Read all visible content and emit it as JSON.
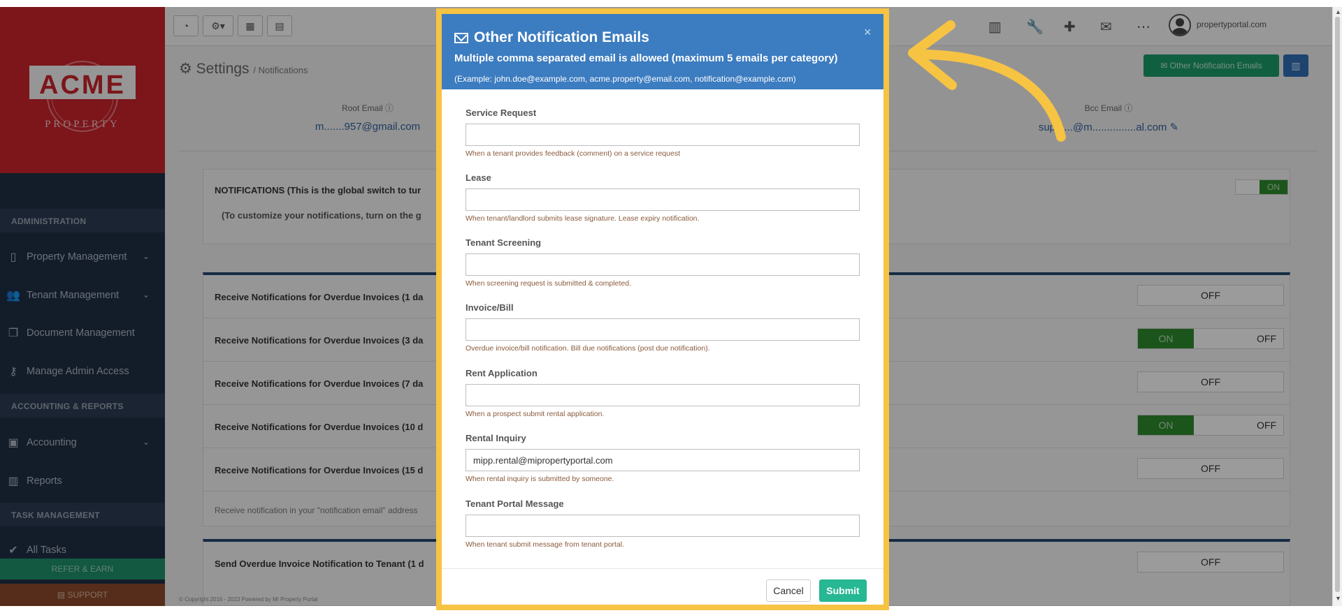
{
  "sidebar": {
    "logo_text": "ACME",
    "logo_sub": "PROPERTY",
    "sections": {
      "administration": "ADMINISTRATION",
      "accounting": "ACCOUNTING & REPORTS",
      "task": "TASK MANAGEMENT"
    },
    "items": {
      "property": "Property Management",
      "tenant": "Tenant Management",
      "document": "Document Management",
      "admin_access": "Manage Admin Access",
      "accounting": "Accounting",
      "reports": "Reports",
      "all_tasks": "All Tasks"
    },
    "refer": "REFER & EARN",
    "support": "SUPPORT"
  },
  "topbar": {
    "user_email": "propertyportal.com"
  },
  "page": {
    "title": "Settings",
    "breadcrumb": "/ Notifications",
    "other_btn": "Other Notification Emails",
    "root_email_label": "Root Email",
    "root_email_value": "m.......957@gmail.com",
    "bcc_email_label": "Bcc Email",
    "bcc_email_value": "supp....@m...............al.com"
  },
  "notifications": {
    "global_title": "NOTIFICATIONS (This is the global switch to tur",
    "global_sub": "(To customize your notifications, turn on the g",
    "global_state": "ON",
    "rows": [
      {
        "label": "Receive Notifications for Overdue Invoices (1 da",
        "state": "OFF"
      },
      {
        "label": "Receive Notifications for Overdue Invoices (3 da",
        "on": "ON",
        "off": "OFF"
      },
      {
        "label": "Receive Notifications for Overdue Invoices (7 da",
        "state": "OFF"
      },
      {
        "label": "Receive Notifications for Overdue Invoices (10 d",
        "on": "ON",
        "off": "OFF"
      },
      {
        "label": "Receive Notifications for Overdue Invoices (15 d",
        "state": "OFF"
      }
    ],
    "note": "Receive notification in your \"notification email\" address",
    "tenant_row": {
      "label": "Send Overdue Invoice Notification to Tenant (1 d",
      "state": "OFF"
    }
  },
  "footer": {
    "copyright": "© Copyright 2016 - 2023 Powered by MI Property Portal"
  },
  "modal": {
    "title": "Other Notification Emails",
    "subtitle": "Multiple comma separated email is allowed (maximum 5 emails per category)",
    "example": "(Example: john.doe@example.com, acme.property@email.com, notification@example.com)",
    "close": "×",
    "fields": [
      {
        "label": "Service Request",
        "value": "",
        "help": "When a tenant provides feedback (comment) on a service request"
      },
      {
        "label": "Lease",
        "value": "",
        "help": "When tenant/landlord submits lease signature. Lease expiry notification."
      },
      {
        "label": "Tenant Screening",
        "value": "",
        "help": "When screening request is submitted & completed."
      },
      {
        "label": "Invoice/Bill",
        "value": "",
        "help": "Overdue invoice/bill notification. Bill due notifications (post due notification)."
      },
      {
        "label": "Rent Application",
        "value": "",
        "help": "When a prospect submit rental application."
      },
      {
        "label": "Rental Inquiry",
        "value": "mipp.rental@mipropertyportal.com",
        "help": "When rental inquiry is submitted by someone."
      },
      {
        "label": "Tenant Portal Message",
        "value": "",
        "help": "When tenant submit message from tenant portal."
      }
    ],
    "cancel": "Cancel",
    "submit": "Submit"
  },
  "colors": {
    "modal_header": "#3c7cc0",
    "highlight_border": "#f6c343",
    "submit": "#26b793",
    "sidebar": "#1f2f45",
    "logo_bg": "#c8252c"
  }
}
